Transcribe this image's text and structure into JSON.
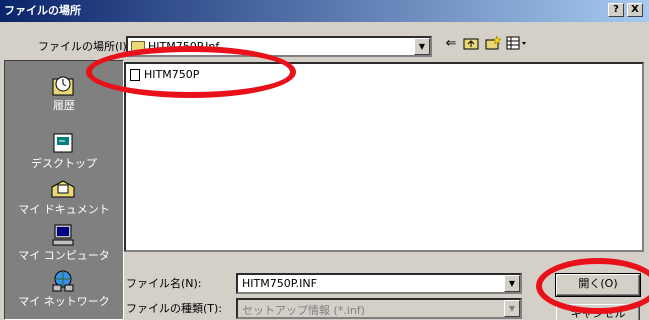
{
  "dialog": {
    "title": "ファイルの場所",
    "help_button": "?",
    "close_button": "X"
  },
  "toolbar": {
    "location_label": "ファイルの場所(I):",
    "location_value": "HITM750P.Inf",
    "back_icon": "back-arrow-icon",
    "up_icon": "up-folder-icon",
    "new_folder_icon": "new-folder-icon",
    "view_menu_icon": "view-menu-icon"
  },
  "places": [
    {
      "label": "履歴",
      "icon": "history-icon"
    },
    {
      "label": "デスクトップ",
      "icon": "desktop-icon"
    },
    {
      "label": "マイ ドキュメント",
      "icon": "my-documents-icon"
    },
    {
      "label": "マイ コンピュータ",
      "icon": "my-computer-icon"
    },
    {
      "label": "マイ ネットワーク",
      "icon": "my-network-icon"
    }
  ],
  "files": [
    {
      "name": "HITM750P",
      "icon": "setup-info-file-icon"
    }
  ],
  "filename_label": "ファイル名(N):",
  "filename_value": "HITM750P.INF",
  "filetype_label": "ファイルの種類(T):",
  "filetype_value": "セットアップ情報 (*.inf)",
  "open_button": "開く(O)",
  "cancel_button": "キャンセル",
  "annotation_color": "#e8111a"
}
